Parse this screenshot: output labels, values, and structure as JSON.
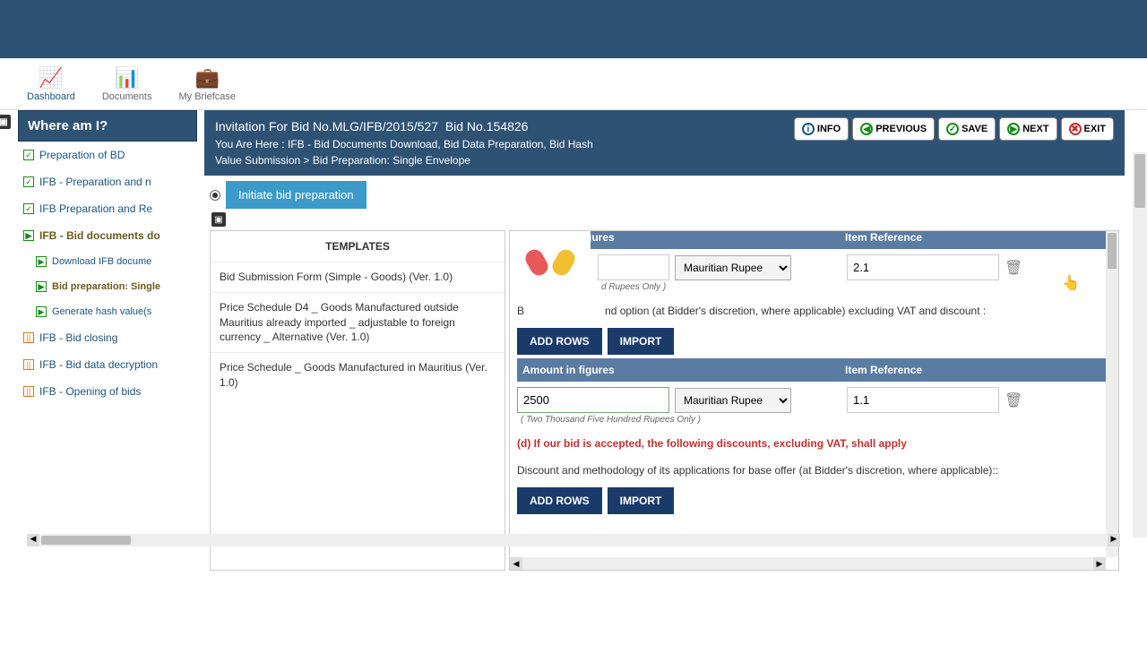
{
  "nav": {
    "dashboard": "Dashboard",
    "documents": "Documents",
    "briefcase": "My Briefcase"
  },
  "sidebar": {
    "title": "Where am I?",
    "items": [
      {
        "label": "Preparation of BD",
        "check": "green"
      },
      {
        "label": "IFB - Preparation and n",
        "check": "green"
      },
      {
        "label": "IFB Preparation and Re",
        "check": "green"
      },
      {
        "label": "IFB - Bid documents do",
        "check": "play",
        "bold": true
      },
      {
        "label": "Download IFB docume",
        "sub": true,
        "check": "play"
      },
      {
        "label": "Bid preparation: Single",
        "sub": true,
        "check": "play",
        "bold": true
      },
      {
        "label": "Generate hash value(s",
        "sub": true,
        "check": "play"
      },
      {
        "label": "IFB - Bid closing",
        "check": "orange"
      },
      {
        "label": "IFB - Bid data decryption",
        "check": "orange"
      },
      {
        "label": "IFB - Opening of bids",
        "check": "orange"
      }
    ]
  },
  "header": {
    "title_prefix": "Invitation For Bid No.",
    "ifb_no": "MLG/IFB/2015/527",
    "bid_no_label": "Bid No.",
    "bid_no": "154826",
    "breadcrumb1": "You Are Here : IFB - Bid Documents Download, Bid Data Preparation, Bid Hash",
    "breadcrumb2": "Value Submission > Bid Preparation: Single Envelope",
    "buttons": {
      "info": "INFO",
      "previous": "PREVIOUS",
      "save": "SAVE",
      "next": "NEXT",
      "exit": "EXIT"
    }
  },
  "init_button": "Initiate bid preparation",
  "templates": {
    "header": "TEMPLATES",
    "items": [
      "Bid Submission Form (Simple - Goods) (Ver. 1.0)",
      "Price Schedule D4 _ Goods Manufactured outside Mauritius already imported _ adjustable to foreign currency _ Alternative (Ver. 1.0)",
      "Price Schedule _ Goods Manufactured in Mauritius (Ver. 1.0)"
    ]
  },
  "form": {
    "col_amount": "Amount in figures",
    "col_ref": "Item Reference",
    "currency": "Mauritian Rupee",
    "row1": {
      "amount": "",
      "ref": "2.1",
      "words": "d Rupees Only )"
    },
    "section_b_text": "nd option (at Bidder's discretion, where applicable) excluding VAT and discount :",
    "add_rows": "ADD ROWS",
    "import": "IMPORT",
    "row2": {
      "amount": "2500",
      "ref": "1.1",
      "words": "( Two Thousand Five Hundred Rupees Only )"
    },
    "section_d": "(d) If our bid is accepted, the following discounts, excluding VAT, shall apply",
    "discount_text": "Discount and methodology of its applications for base offer (at Bidder's discretion, where applicable)::"
  }
}
